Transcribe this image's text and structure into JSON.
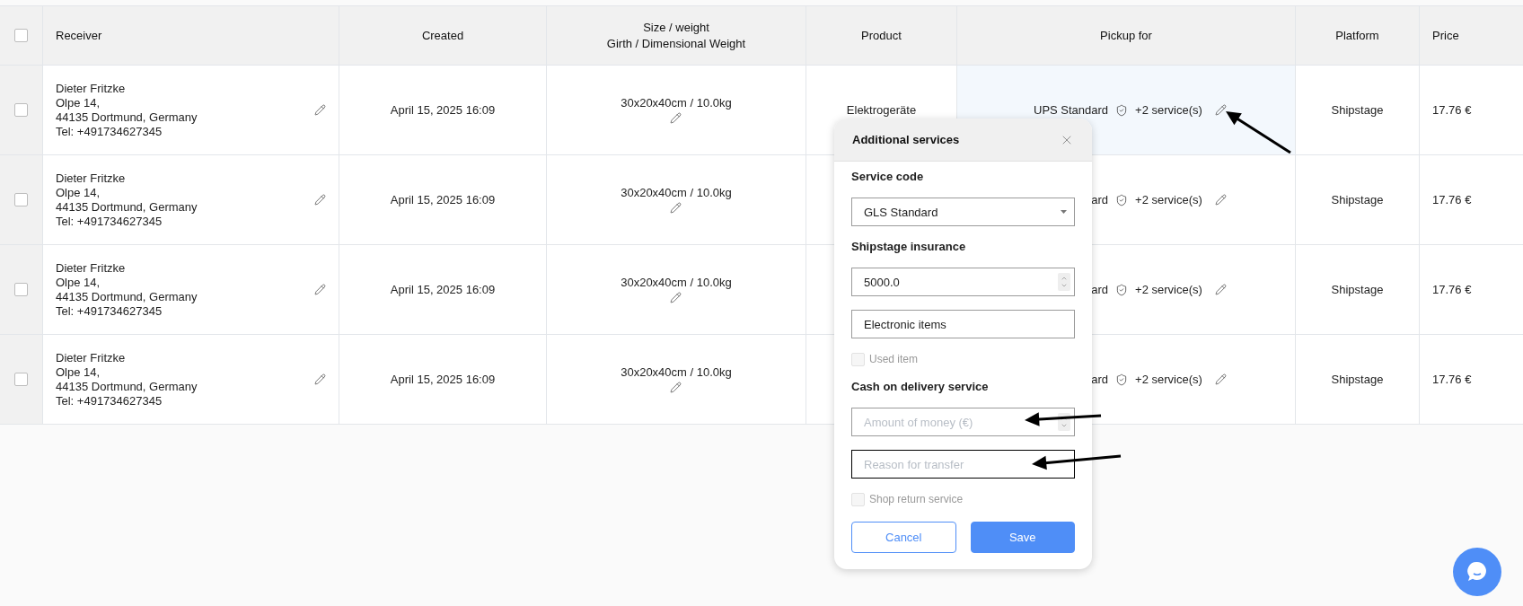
{
  "table": {
    "columns": [
      {
        "kind": "checkbox",
        "checked": false
      },
      {
        "kind": "text",
        "label": "Receiver"
      },
      {
        "kind": "text",
        "label": "Created"
      },
      {
        "kind": "text",
        "label": "Size / weight",
        "sublabel": "Girth / Dimensional Weight"
      },
      {
        "kind": "text",
        "label": "Product"
      },
      {
        "kind": "text",
        "label": "Pickup for"
      },
      {
        "kind": "text",
        "label": "Platform"
      },
      {
        "kind": "text",
        "label": "Price"
      }
    ],
    "rows": [
      {
        "checked": false,
        "receiver": [
          "Dieter Fritzke",
          "Olpe 14,",
          "44135 Dortmund, Germany",
          "Tel: +491734627345"
        ],
        "created": "April 15, 2025 16:09",
        "size": "30x20x40cm / 10.0kg",
        "product": "Elektrogeräte",
        "pickup": {
          "service": "UPS Standard",
          "extra": "+2 service(s)",
          "selected": true
        },
        "platform": "Shipstage",
        "price": "17.76 €"
      },
      {
        "checked": false,
        "receiver": [
          "Dieter Fritzke",
          "Olpe 14,",
          "44135 Dortmund, Germany",
          "Tel: +491734627345"
        ],
        "created": "April 15, 2025 16:09",
        "size": "30x20x40cm / 10.0kg",
        "pickup": {
          "service": "ard",
          "extra": "+2 service(s)",
          "selected": false
        },
        "platform": "Shipstage",
        "price": "17.76 €"
      },
      {
        "checked": false,
        "receiver": [
          "Dieter Fritzke",
          "Olpe 14,",
          "44135 Dortmund, Germany",
          "Tel: +491734627345"
        ],
        "created": "April 15, 2025 16:09",
        "size": "30x20x40cm / 10.0kg",
        "pickup": {
          "service": "ard",
          "extra": "+2 service(s)",
          "selected": false
        },
        "platform": "Shipstage",
        "price": "17.76 €"
      },
      {
        "checked": false,
        "receiver": [
          "Dieter Fritzke",
          "Olpe 14,",
          "44135 Dortmund, Germany",
          "Tel: +491734627345"
        ],
        "created": "April 15, 2025 16:09",
        "size": "30x20x40cm / 10.0kg",
        "pickup": {
          "service": "ard",
          "extra": "+2 service(s)",
          "selected": false
        },
        "platform": "Shipstage",
        "price": "17.76 €"
      }
    ]
  },
  "dialog": {
    "title": "Additional services",
    "fields": [
      {
        "kind": "heading",
        "text": "Service code"
      },
      {
        "kind": "select",
        "value": "GLS Standard"
      },
      {
        "kind": "heading",
        "text": "Shipstage insurance"
      },
      {
        "kind": "number",
        "value": "5000.0"
      },
      {
        "kind": "text",
        "value": "Electronic items"
      },
      {
        "kind": "checkbox",
        "label": "Used item",
        "checked": false,
        "disabled": true
      },
      {
        "kind": "heading",
        "text": "Cash on delivery service"
      },
      {
        "kind": "number",
        "placeholder": "Amount of money (€)"
      },
      {
        "kind": "text",
        "placeholder": "Reason for transfer",
        "focused": true
      },
      {
        "kind": "checkbox",
        "label": "Shop return service",
        "checked": false,
        "disabled": true
      }
    ],
    "buttons": [
      {
        "kind": "secondary",
        "label": "Cancel"
      },
      {
        "kind": "primary",
        "label": "Save"
      }
    ]
  }
}
